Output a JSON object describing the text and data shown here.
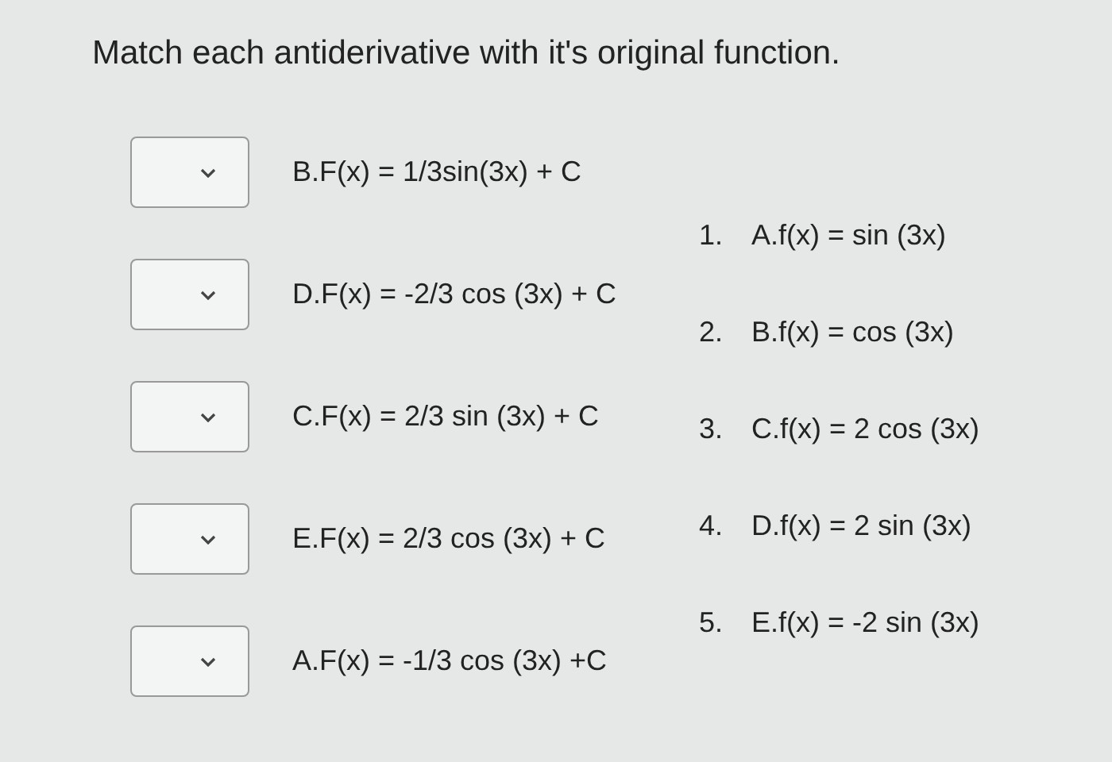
{
  "question": "Match each antiderivative with it's original function.",
  "prompts": [
    {
      "text": "B.F(x) = 1/3sin(3x) + C"
    },
    {
      "text": "D.F(x) = -2/3 cos (3x) + C"
    },
    {
      "text": "C.F(x) = 2/3 sin (3x) + C"
    },
    {
      "text": "E.F(x) = 2/3 cos (3x) + C"
    },
    {
      "text": "A.F(x) = -1/3 cos (3x) +C"
    }
  ],
  "answers": [
    {
      "number": "1.",
      "text": "A.f(x) = sin (3x)"
    },
    {
      "number": "2.",
      "text": "B.f(x) = cos (3x)"
    },
    {
      "number": "3.",
      "text": "C.f(x) = 2 cos (3x)"
    },
    {
      "number": "4.",
      "text": "D.f(x) = 2 sin (3x)"
    },
    {
      "number": "5.",
      "text": "E.f(x) = -2 sin (3x)"
    }
  ]
}
